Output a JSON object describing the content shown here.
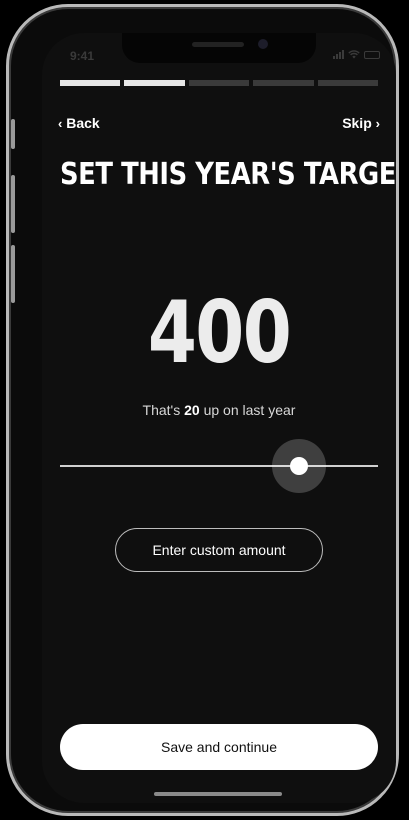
{
  "status_bar": {
    "time": "9:41"
  },
  "progress": {
    "total_steps": 5,
    "completed_steps": 2
  },
  "nav": {
    "back_label": "Back",
    "back_chevron": "‹",
    "skip_label": "Skip",
    "skip_chevron": "›"
  },
  "title": "SET THIS YEAR'S TARGET",
  "target": {
    "value": "400",
    "subtext_prefix": "That's ",
    "subtext_amount": "20",
    "subtext_suffix": " up on last year"
  },
  "slider": {
    "level": 0.75
  },
  "buttons": {
    "custom_amount_label": "Enter custom amount",
    "save_label": "Save and continue"
  },
  "colors": {
    "background": "#0f0f0f",
    "accent": "#ffffff",
    "inactive_progress": "#3a3a3a"
  }
}
